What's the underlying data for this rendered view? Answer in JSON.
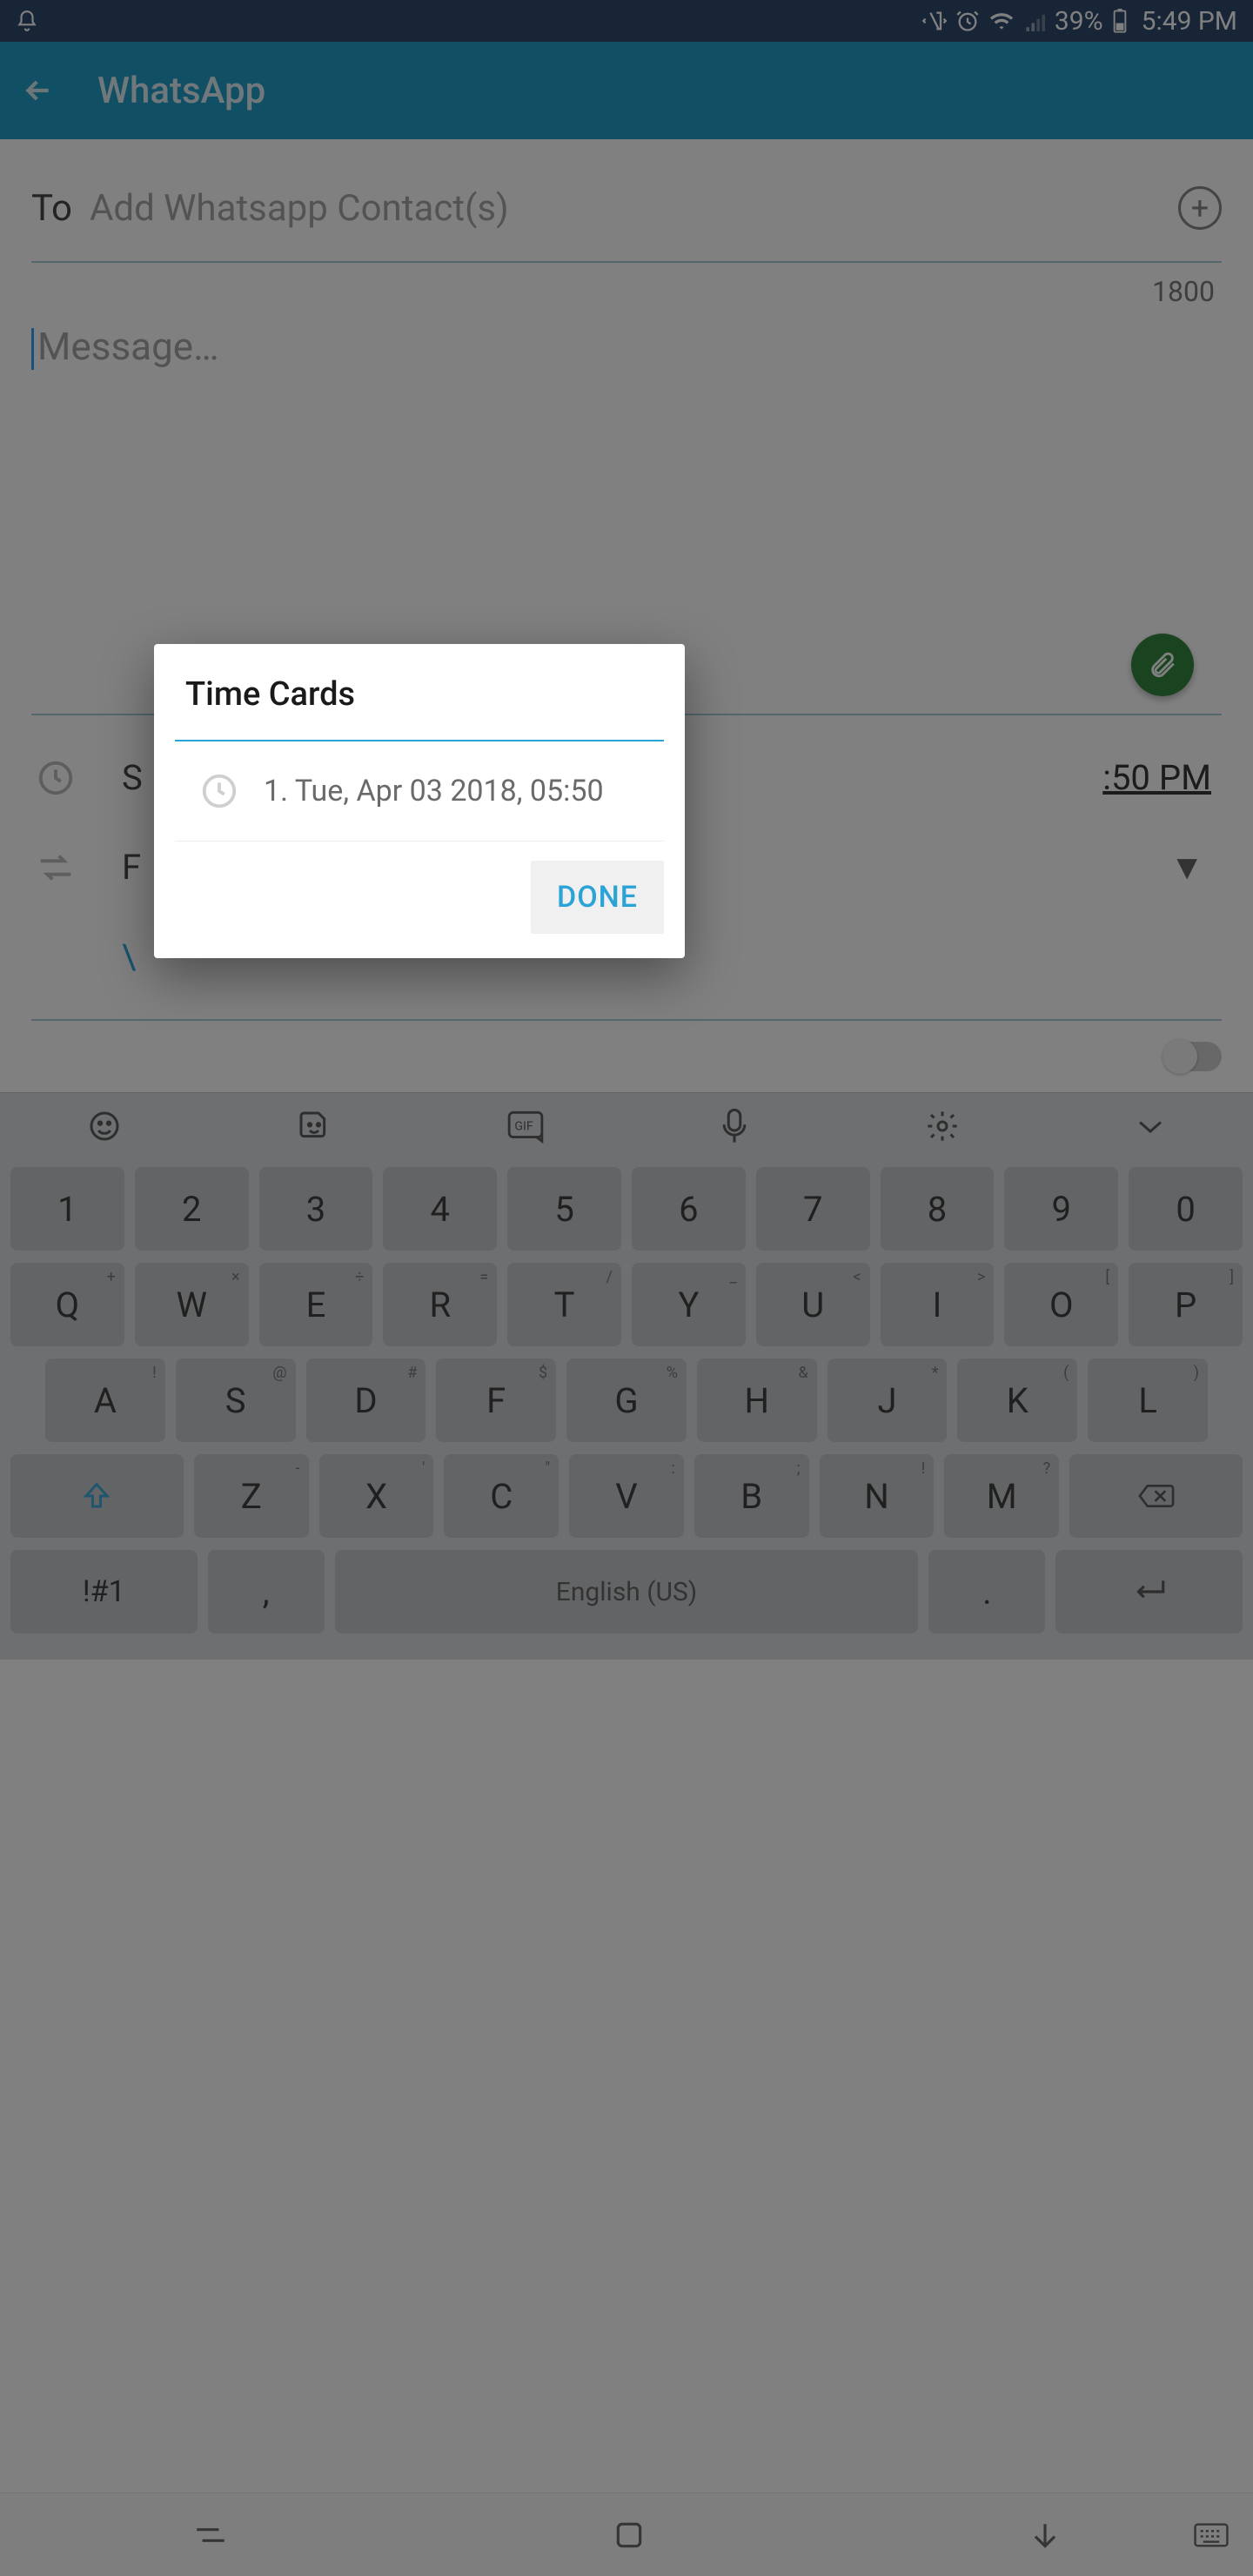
{
  "status": {
    "battery_pct": "39%",
    "time": "5:49 PM"
  },
  "appbar": {
    "title": "WhatsApp"
  },
  "compose": {
    "to_label": "To",
    "to_placeholder": "Add Whatsapp Contact(s)",
    "char_count": "1800",
    "message_placeholder": "Message…"
  },
  "schedule": {
    "time_visible": ":50 PM"
  },
  "dialog": {
    "title": "Time Cards",
    "item": "1. Tue, Apr 03 2018, 05:50",
    "done": "DONE"
  },
  "keyboard": {
    "row1": [
      "1",
      "2",
      "3",
      "4",
      "5",
      "6",
      "7",
      "8",
      "9",
      "0"
    ],
    "row2": [
      "Q",
      "W",
      "E",
      "R",
      "T",
      "Y",
      "U",
      "I",
      "O",
      "P"
    ],
    "row2_sup": [
      "+",
      "×",
      "÷",
      "=",
      "/",
      "_",
      "<",
      ">",
      "[",
      "]"
    ],
    "row3": [
      "A",
      "S",
      "D",
      "F",
      "G",
      "H",
      "J",
      "K",
      "L"
    ],
    "row3_sup": [
      "!",
      "@",
      "#",
      "$",
      "%",
      "&",
      "*",
      "(",
      ")"
    ],
    "row4": [
      "Z",
      "X",
      "C",
      "V",
      "B",
      "N",
      "M"
    ],
    "row4_sup": [
      "‑",
      "'",
      "\"",
      ":",
      ";",
      "!",
      "?"
    ],
    "sym": "!#1",
    "space": "English (US)",
    "comma": ",",
    "dot": "."
  }
}
